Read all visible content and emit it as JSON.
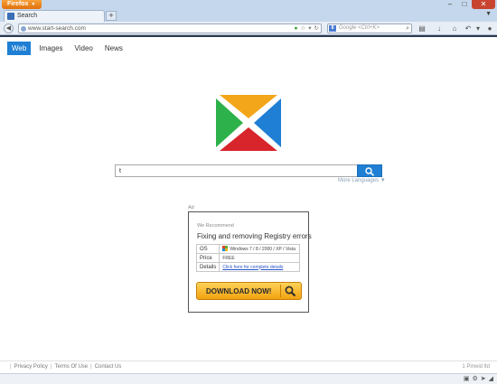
{
  "browser": {
    "app_button": "Firefox",
    "tab_title": "Search",
    "url": "www.start-search.com",
    "search_placeholder": "Google <Ctrl+K>",
    "search_engine_label": "8"
  },
  "nav": {
    "tabs": [
      {
        "label": "Web",
        "active": true
      },
      {
        "label": "Images",
        "active": false
      },
      {
        "label": "Video",
        "active": false
      },
      {
        "label": "News",
        "active": false
      }
    ]
  },
  "logo": {
    "icon": "x-logo-icon",
    "colors": {
      "top": "#f3a61a",
      "right": "#1f7fd4",
      "bottom": "#d8242b",
      "left": "#2db14a"
    }
  },
  "search": {
    "value": "t",
    "more_languages": "More Languages ▼"
  },
  "ad": {
    "label": "Ad",
    "recommend": "We Recommend",
    "title": "Fixing and removing Registry errors",
    "rows": [
      {
        "key": "OS",
        "value": "Windows 7 / 8 / 2000 / XP / Vista"
      },
      {
        "key": "Price",
        "value": "FREE"
      },
      {
        "key": "Details",
        "value": "Click here for complete details"
      }
    ],
    "button": "DOWNLOAD NOW!"
  },
  "footer": {
    "links": [
      "Privacy Policy",
      "Terms Of Use",
      "Contact Us"
    ],
    "right": "1 Pinwid ltd"
  },
  "colors": {
    "accent": "#1f7fd4",
    "firefox_orange": "#e1700b"
  }
}
